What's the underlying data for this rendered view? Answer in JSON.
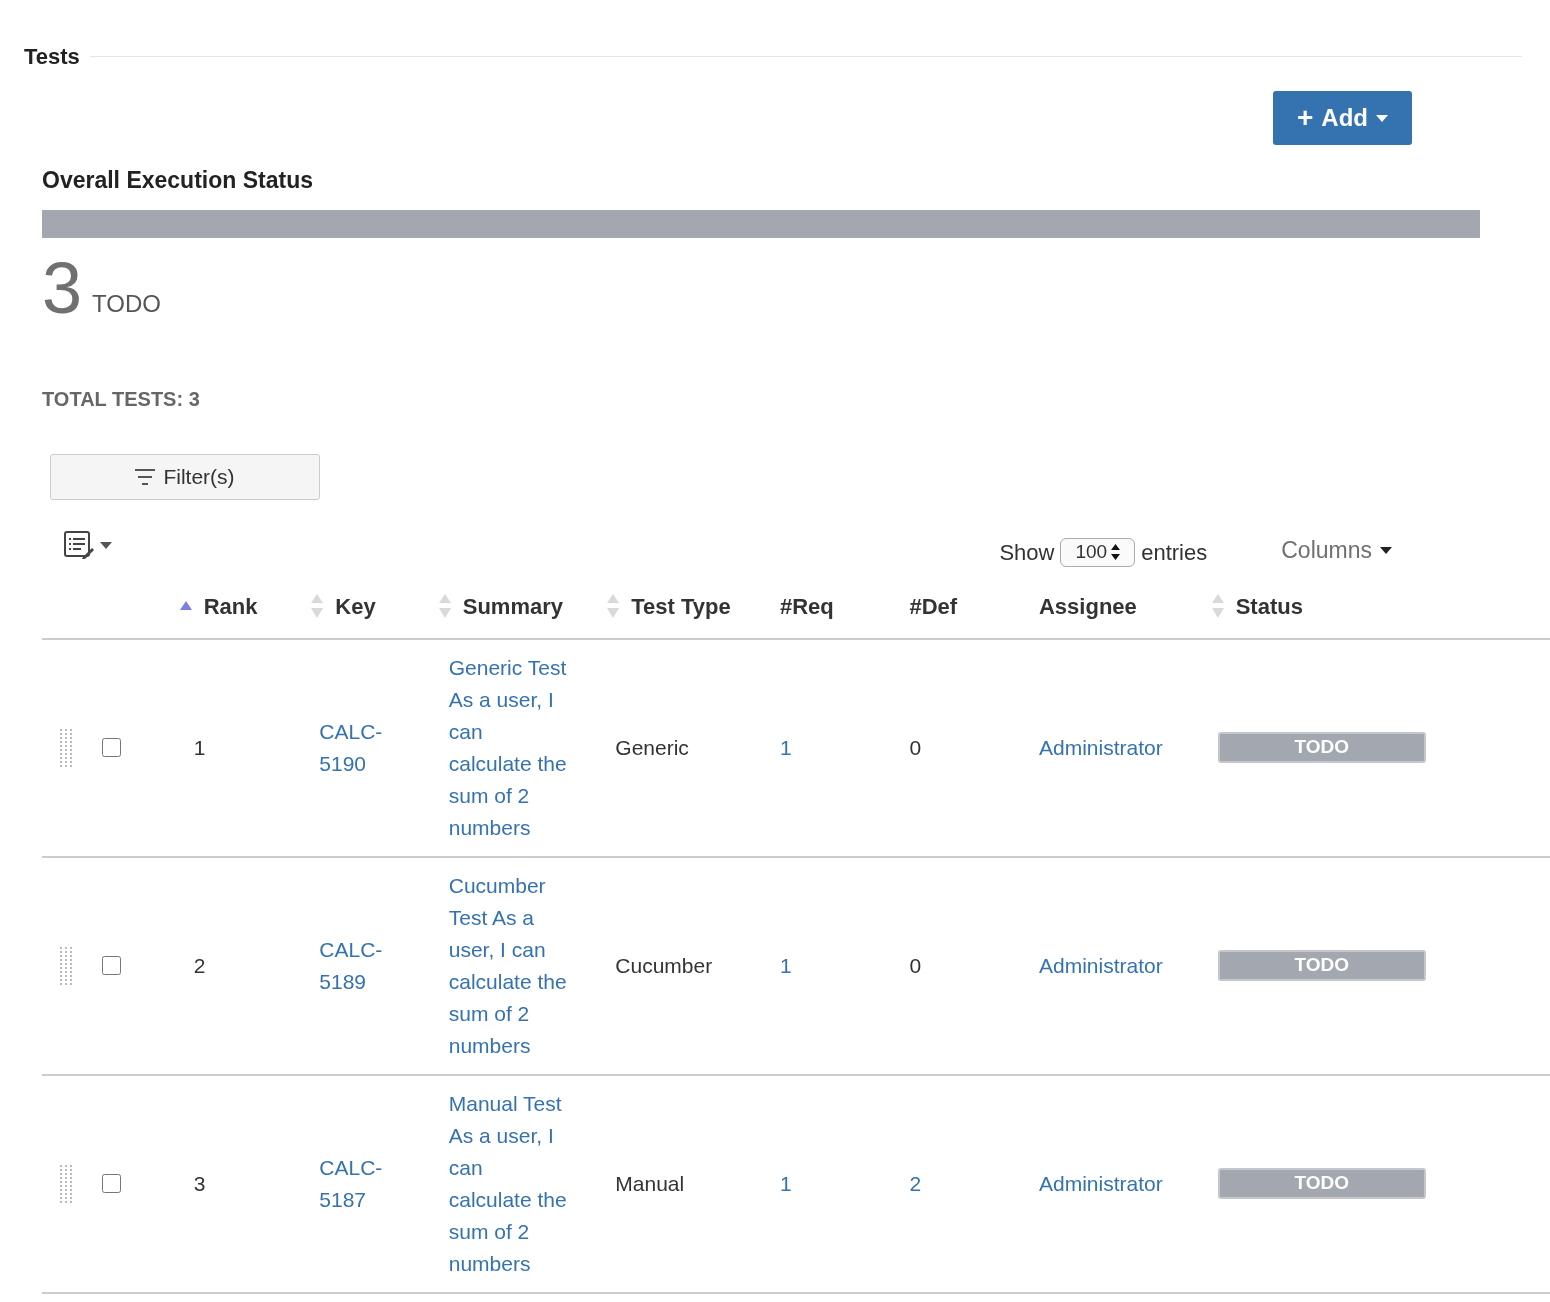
{
  "section_title": "Tests",
  "add_button": {
    "icon": "+",
    "label": "Add"
  },
  "execution_status": {
    "title": "Overall Execution Status",
    "segments": [
      {
        "count": "3",
        "label": "TODO",
        "level": 1,
        "color": "#a3a7af"
      }
    ]
  },
  "total_tests": "TOTAL TESTS: 3",
  "filter_button": {
    "label": "Filter(s)"
  },
  "show_entries": {
    "prefix": "Show",
    "value": "100",
    "suffix": "entries"
  },
  "columns_button": {
    "label": "Columns"
  },
  "table": {
    "columns": [
      {
        "label": "Rank",
        "sortable": true,
        "sorted": true
      },
      {
        "label": "Key",
        "sortable": true,
        "sorted": false
      },
      {
        "label": "Summary",
        "sortable": true,
        "sorted": false
      },
      {
        "label": "Test Type",
        "sortable": true,
        "sorted": false
      },
      {
        "label": "#Req",
        "sortable": false
      },
      {
        "label": "#Def",
        "sortable": false
      },
      {
        "label": "Assignee",
        "sortable": false
      },
      {
        "label": "Status",
        "sortable": true,
        "sorted": false
      }
    ],
    "rows": [
      {
        "checked": false,
        "rank": "1",
        "key": "CALC-5190",
        "summary": "Generic Test As a user, I can calculate the sum of 2 numbers",
        "test_type": "Generic",
        "req": {
          "text": "1",
          "link": true
        },
        "def": {
          "text": "0",
          "link": false
        },
        "assignee": "Administrator",
        "status": {
          "label": "TODO",
          "color": "#a3a7af"
        }
      },
      {
        "checked": false,
        "rank": "2",
        "key": "CALC-5189",
        "summary": "Cucumber Test As a user, I can calculate the sum of 2 numbers",
        "test_type": "Cucumber",
        "req": {
          "text": "1",
          "link": true
        },
        "def": {
          "text": "0",
          "link": false
        },
        "assignee": "Administrator",
        "status": {
          "label": "TODO",
          "color": "#a3a7af"
        }
      },
      {
        "checked": false,
        "rank": "3",
        "key": "CALC-5187",
        "summary": "Manual Test As a user, I can calculate the sum of 2 numbers",
        "test_type": "Manual",
        "req": {
          "text": "1",
          "link": true
        },
        "def": {
          "text": "2",
          "link": true
        },
        "assignee": "Administrator",
        "status": {
          "label": "TODO",
          "color": "#a3a7af"
        }
      }
    ]
  }
}
